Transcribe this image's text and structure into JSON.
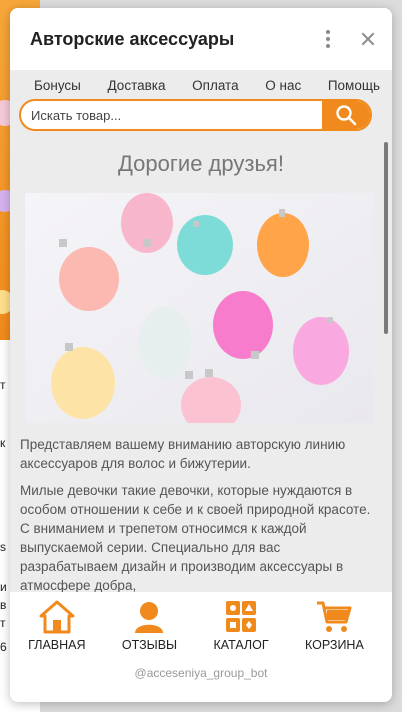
{
  "window": {
    "title": "Авторские аксессуары"
  },
  "nav": {
    "items": [
      "Бонусы",
      "Доставка",
      "Оплата",
      "О нас",
      "Помощь"
    ]
  },
  "search": {
    "placeholder": "Искать товар..."
  },
  "main": {
    "heading": "Дорогие друзья!",
    "paragraph1": "Представляем вашему вниманию авторскую линию аксессуаров для волос и бижутерии.",
    "paragraph2": "Милые девочки такие девочки, которые нуждаются в особом отношении к себе и к своей природной красоте. С вниманием и трепетом относимся к каждой выпускаемой серии. Специально для вас разрабатываем дизайн и производим аксессуары в атмосфере добра,"
  },
  "bottom_nav": {
    "home": "ГЛАВНАЯ",
    "reviews": "ОТЗЫВЫ",
    "catalog": "КАТАЛОГ",
    "cart": "КОРЗИНА"
  },
  "footer": {
    "bot": "@acceseniya_group_bot"
  },
  "background": {
    "fragments": [
      "т",
      "к",
      "s",
      "и",
      "в",
      "т",
      "6"
    ]
  },
  "colors": {
    "accent": "#f08a1c",
    "panel": "#ececec"
  },
  "icons": [
    "kebab-menu-icon",
    "close-icon",
    "search-icon",
    "home-icon",
    "user-icon",
    "catalog-grid-icon",
    "cart-icon"
  ]
}
